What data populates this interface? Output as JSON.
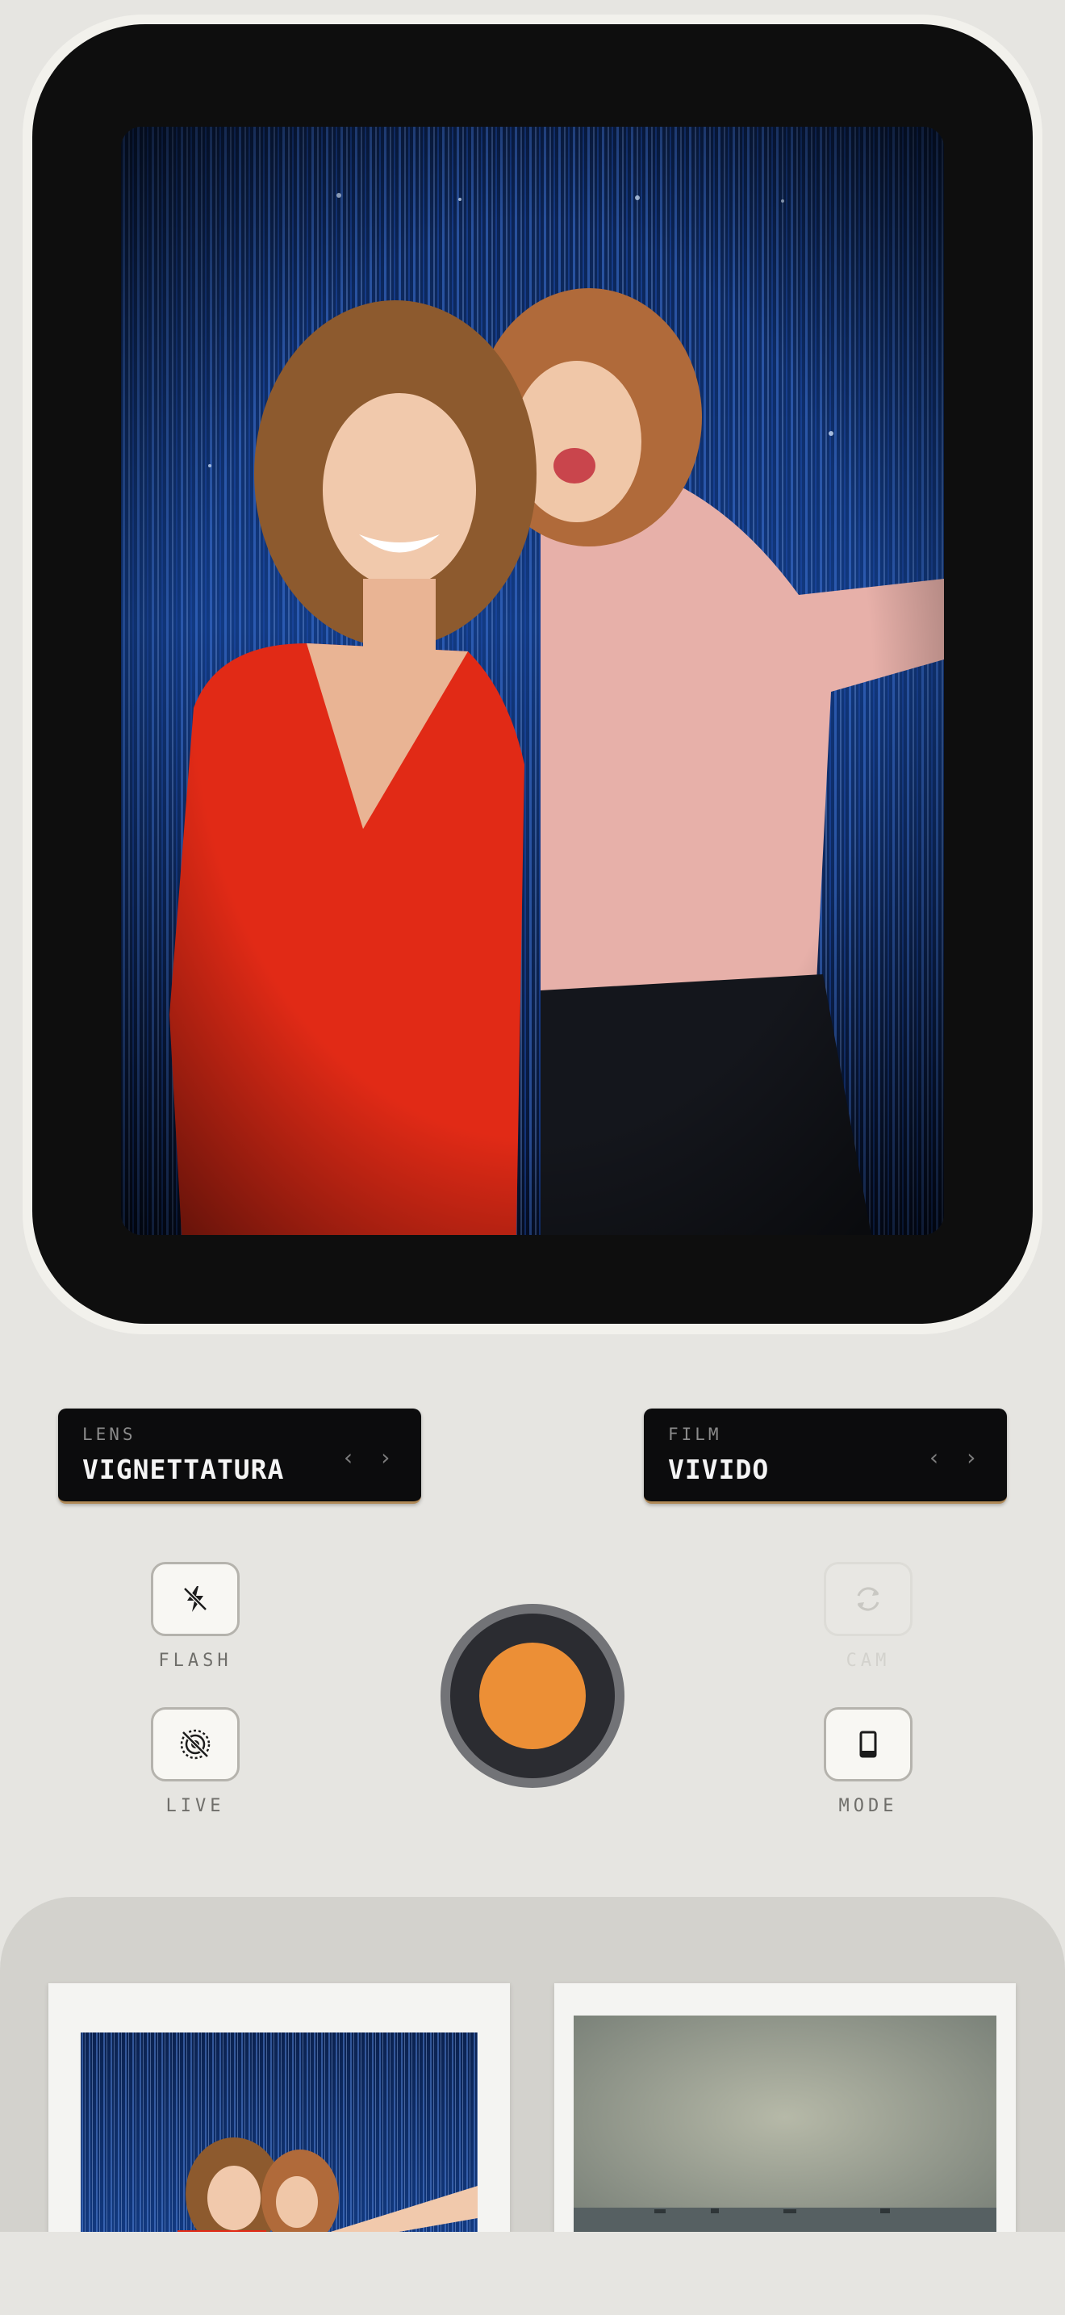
{
  "lens": {
    "kicker": "LENS",
    "value": "VIGNETTATURA",
    "arrows": "‹ ›"
  },
  "film": {
    "kicker": "FILM",
    "value": "VIVIDO",
    "arrows": "‹ ›"
  },
  "controls": {
    "flash": {
      "label": "FLASH",
      "icon": "flash-off-icon"
    },
    "cam": {
      "label": "CAM",
      "icon": "flip-camera-icon",
      "disabled": true
    },
    "live": {
      "label": "LIVE",
      "icon": "live-photo-off-icon"
    },
    "mode": {
      "label": "MODE",
      "icon": "portrait-mode-icon"
    }
  },
  "colors": {
    "shutter": "#ec8f36",
    "background": "#e6e5e1",
    "viewfinder": "#0e0e0e",
    "accent_underline": "#b08a58"
  },
  "gallery": {
    "items": [
      {
        "name": "party-photo-print"
      },
      {
        "name": "seascape-photo-print"
      }
    ]
  }
}
